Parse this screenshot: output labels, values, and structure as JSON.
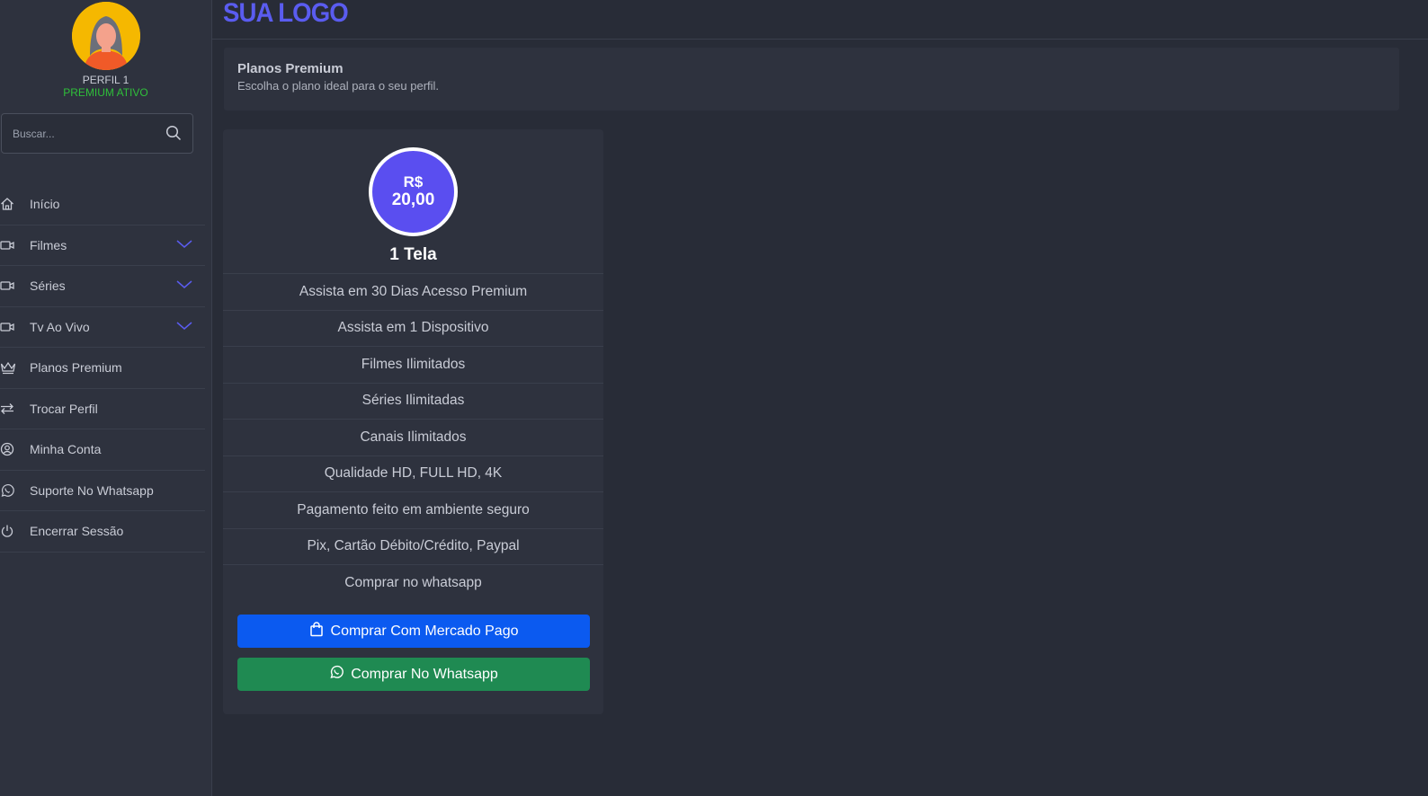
{
  "profile": {
    "name": "PERFIL 1",
    "status": "PREMIUM ATIVO"
  },
  "search": {
    "placeholder": "Buscar..."
  },
  "nav": {
    "items": [
      {
        "label": "Início",
        "icon": "home-icon"
      },
      {
        "label": "Filmes",
        "icon": "video-camera-icon",
        "expandable": true
      },
      {
        "label": "Séries",
        "icon": "video-camera-icon",
        "expandable": true
      },
      {
        "label": "Tv Ao Vivo",
        "icon": "video-camera-icon",
        "expandable": true
      },
      {
        "label": "Planos Premium",
        "icon": "crown-icon"
      },
      {
        "label": "Trocar Perfil",
        "icon": "swap-arrows-icon"
      },
      {
        "label": "Minha Conta",
        "icon": "user-circle-icon"
      },
      {
        "label": "Suporte No Whatsapp",
        "icon": "whatsapp-icon"
      },
      {
        "label": "Encerrar Sessão",
        "icon": "power-icon"
      }
    ]
  },
  "header": {
    "logo": "SUA LOGO"
  },
  "page": {
    "title": "Planos Premium",
    "subtitle": "Escolha o plano ideal para o seu perfil."
  },
  "plan": {
    "currency": "R$",
    "price": "20,00",
    "name": "1 Tela",
    "features": [
      "Assista em 30 Dias Acesso Premium",
      "Assista em 1 Dispositivo",
      "Filmes Ilimitados",
      "Séries Ilimitadas",
      "Canais Ilimitados",
      "Qualidade HD, FULL HD, 4K",
      "Pagamento feito em ambiente seguro",
      "Pix, Cartão Débito/Crédito, Paypal",
      "Comprar no whatsapp"
    ],
    "buy_mercado_pago": "Comprar Com Mercado Pago",
    "buy_whatsapp": "Comprar No Whatsapp"
  },
  "colors": {
    "background": "#282c37",
    "panel": "#2e323e",
    "accent": "#5a5cf0",
    "status_green": "#2fbf3a",
    "mercado_pago_button": "#0b5af0",
    "whatsapp_button": "#1f8a52"
  }
}
